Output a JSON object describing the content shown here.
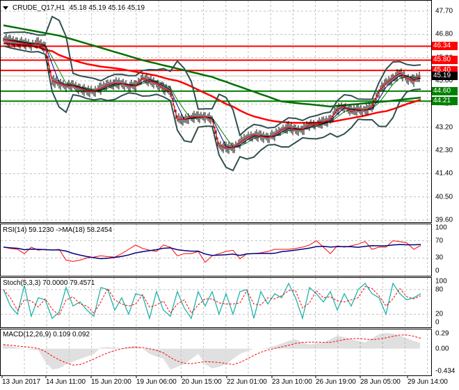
{
  "header": {
    "symbol": "CRUDE_Q17,H1",
    "ohlc": "45.18 45.19 45.16 45.19"
  },
  "chart_data": [
    {
      "type": "candlestick",
      "title": "CRUDE_Q17,H1",
      "ylim": [
        39.6,
        47.7
      ],
      "y_ticks": [
        "47.70",
        "46.80",
        "45.90",
        "45.00",
        "44.10",
        "43.20",
        "42.30",
        "41.40",
        "40.50",
        "39.60"
      ],
      "x_ticks": [
        "13 Jun 2017",
        "14 Jun 11:00",
        "15 Jun 20:00",
        "19 Jun 06:00",
        "20 Jun 15:00",
        "22 Jun 01:00",
        "23 Jun 10:00",
        "26 Jun 19:00",
        "28 Jun 05:00",
        "29 Jun 14:00"
      ],
      "grid": true,
      "close": [
        46.6,
        46.55,
        46.5,
        46.45,
        46.4,
        46.45,
        46.3,
        45.0,
        44.9,
        44.8,
        44.8,
        44.7,
        44.6,
        44.6,
        44.7,
        44.85,
        44.9,
        44.9,
        44.8,
        44.8,
        45.1,
        45.0,
        44.9,
        44.7,
        44.6,
        43.5,
        43.5,
        43.6,
        43.6,
        43.6,
        43.5,
        42.5,
        42.4,
        42.4,
        42.6,
        42.8,
        42.9,
        42.85,
        42.8,
        42.9,
        43.1,
        43.2,
        43.1,
        43.1,
        43.3,
        43.3,
        43.4,
        43.5,
        43.9,
        44.0,
        43.8,
        43.9,
        43.85,
        44.0,
        44.6,
        44.9,
        45.1,
        45.3,
        45.1,
        45.0,
        45.19
      ],
      "ma_long": [
        47.15,
        47.1,
        47.05,
        47.0,
        46.95,
        46.9,
        46.85,
        46.8,
        46.75,
        46.68,
        46.6,
        46.52,
        46.44,
        46.36,
        46.28,
        46.2,
        46.12,
        46.04,
        45.96,
        45.88,
        45.8,
        45.73,
        45.67,
        45.6,
        45.54,
        45.47,
        45.41,
        45.34,
        45.28,
        45.21,
        45.15,
        45.05,
        44.96,
        44.86,
        44.77,
        44.67,
        44.58,
        44.48,
        44.39,
        44.29,
        44.2,
        44.17,
        44.14,
        44.11,
        44.09,
        44.06,
        44.03,
        44.0,
        44.03,
        44.05,
        44.08,
        44.1,
        44.13,
        44.15,
        44.18,
        44.2,
        44.23,
        44.26,
        44.29,
        44.32,
        44.35
      ],
      "ma_mid": [
        46.45,
        46.42,
        46.4,
        46.38,
        46.35,
        46.3,
        46.2,
        46.15,
        46.0,
        45.9,
        45.8,
        45.72,
        45.65,
        45.6,
        45.55,
        45.52,
        45.49,
        45.45,
        45.4,
        45.35,
        45.3,
        45.25,
        45.2,
        45.12,
        45.05,
        45.0,
        44.9,
        44.78,
        44.65,
        44.52,
        44.4,
        44.25,
        44.1,
        44.0,
        43.85,
        43.72,
        43.62,
        43.55,
        43.48,
        43.43,
        43.4,
        43.38,
        43.37,
        43.37,
        43.37,
        43.38,
        43.39,
        43.4,
        43.45,
        43.5,
        43.55,
        43.6,
        43.65,
        43.72,
        43.78,
        43.82,
        43.9,
        44.0,
        44.1,
        44.18,
        44.27
      ],
      "colors": {
        "ma_long": "#007000",
        "ma_mid": "#ff0000",
        "bands": "#2f4f4f",
        "bars": "#000000"
      },
      "levels": [
        {
          "price": "46.34",
          "color": "#ff0000"
        },
        {
          "price": "45.80",
          "color": "#ff0000"
        },
        {
          "price": "45.40",
          "color": "#ff0000"
        },
        {
          "price": "44.60",
          "color": "#008000"
        },
        {
          "price": "44.21",
          "color": "#008000"
        }
      ],
      "current_price": "45.19"
    },
    {
      "type": "line",
      "title": "RSI(14) 59.1230  ->MA(18) 58.2454",
      "ylim": [
        0,
        100
      ],
      "y_ticks": [
        "100",
        "70",
        "30",
        "0"
      ],
      "series": [
        {
          "name": "RSI(14)",
          "color": "#ff0000",
          "values": [
            55,
            52,
            50,
            40,
            55,
            48,
            50,
            48,
            50,
            25,
            22,
            25,
            30,
            32,
            35,
            33,
            32,
            40,
            50,
            60,
            52,
            48,
            45,
            60,
            55,
            35,
            40,
            40,
            45,
            20,
            35,
            40,
            45,
            48,
            28,
            40,
            40,
            42,
            45,
            50,
            50,
            50,
            52,
            55,
            60,
            70,
            55,
            40,
            58,
            55,
            58,
            62,
            68,
            50,
            55,
            55,
            70,
            68,
            65,
            50,
            59
          ]
        },
        {
          "name": "MA(18)",
          "color": "#000080"
        }
      ]
    },
    {
      "type": "line",
      "title": "Stoch(5,3,3) 70.0000 79.4571",
      "ylim": [
        0,
        100
      ],
      "y_ticks": [
        "100",
        "80",
        "20",
        "0"
      ],
      "series": [
        {
          "name": "main",
          "color": "#20b2aa",
          "values": [
            80,
            40,
            20,
            90,
            15,
            60,
            55,
            10,
            25,
            85,
            40,
            50,
            30,
            15,
            85,
            80,
            30,
            60,
            20,
            70,
            65,
            10,
            75,
            30,
            15,
            75,
            35,
            10,
            75,
            40,
            75,
            20,
            70,
            20,
            75,
            80,
            10,
            75,
            45,
            70,
            60,
            95,
            60,
            10,
            85,
            70,
            50,
            75,
            30,
            70,
            40,
            80,
            95,
            70,
            60,
            20,
            95,
            70,
            55,
            60,
            70
          ]
        },
        {
          "name": "signal",
          "color": "#ff0000"
        }
      ]
    },
    {
      "type": "bar",
      "title": "MACD(12,26,9) 0.109 0.092",
      "ylim": [
        -0.434,
        0.29
      ],
      "y_ticks": [
        "0.29",
        "0.00",
        "-0.434"
      ],
      "series": [
        {
          "name": "histogram",
          "color": "#c0c0c0",
          "values": [
            0.08,
            0.05,
            0.02,
            0,
            -0.02,
            -0.03,
            -0.25,
            -0.4,
            -0.38,
            -0.3,
            -0.25,
            -0.2,
            -0.15,
            -0.1,
            0.02,
            0.03,
            0.02,
            0.01,
            0.03,
            0.05,
            0.0,
            -0.1,
            -0.15,
            -0.2,
            -0.4,
            -0.35,
            -0.3,
            -0.2,
            -0.1,
            -0.3,
            -0.38,
            -0.35,
            -0.3,
            -0.2,
            -0.1,
            -0.05,
            0,
            0,
            0.02,
            0.05,
            0.1,
            0.15,
            0.18,
            0.12,
            0.08,
            0.1,
            0.12,
            0.18,
            0.25,
            0.22,
            0.18,
            0.15,
            0.12,
            0.2,
            0.28,
            0.3,
            0.29,
            0.25,
            0.2,
            0.15,
            0.11
          ]
        },
        {
          "name": "signal",
          "color": "#ff0000"
        }
      ]
    }
  ]
}
